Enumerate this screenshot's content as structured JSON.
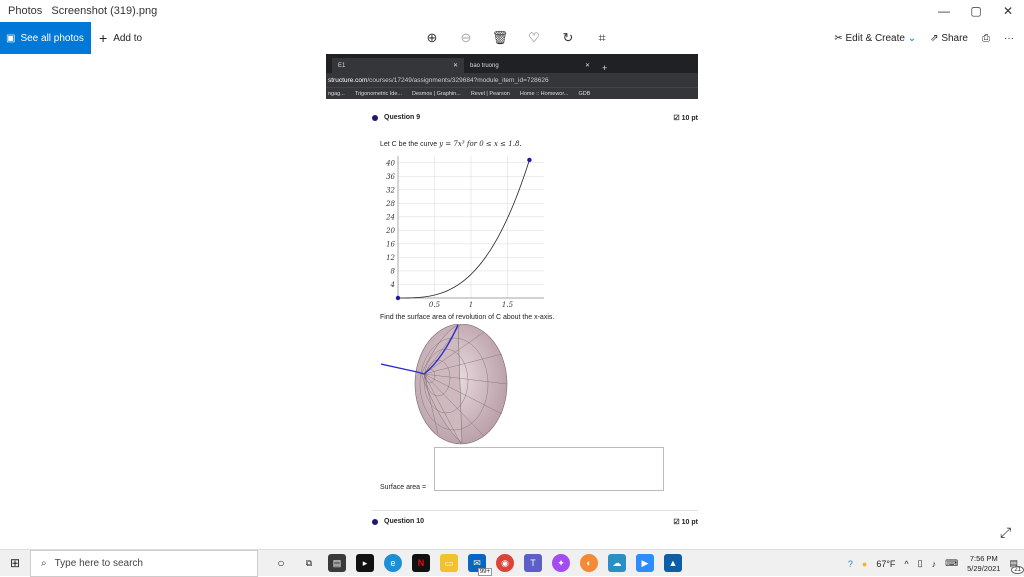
{
  "window": {
    "app": "Photos",
    "filename": "Screenshot (319).png",
    "minimize": "—",
    "maximize": "▢",
    "close": "✕"
  },
  "toolbar": {
    "see_all": "See all photos",
    "add_to": "Add to",
    "edit_create": "Edit & Create",
    "share": "Share"
  },
  "browser": {
    "tabs": [
      {
        "label": "E1"
      },
      {
        "label": "bao truong"
      }
    ],
    "new_tab": "+",
    "url_domain": "structure.com",
    "url_path": "/courses/17249/assignments/329684?module_item_id=728626",
    "bookmarks": [
      "ngag...",
      "Trigonometric Ide...",
      "Desmos | Graphin...",
      "Revel | Pearson",
      "Home :: Homewor...",
      "GDB"
    ]
  },
  "question9": {
    "title": "Question 9",
    "points": "10 pt",
    "prompt_pre": "Let C be the curve ",
    "prompt_math": "y = 7x³ for 0 ≤ x ≤ 1.8.",
    "find": "Find the surface area of revolution of C about the x-axis.",
    "answer_label": "Surface area =",
    "answer_value": ""
  },
  "question10": {
    "title": "Question 10",
    "points": "10 pt"
  },
  "chart_data": {
    "type": "line",
    "x": [
      0,
      0.2,
      0.4,
      0.6,
      0.8,
      1.0,
      1.2,
      1.4,
      1.6,
      1.8
    ],
    "y": [
      0,
      0.056,
      0.448,
      1.512,
      3.584,
      7.0,
      12.096,
      19.208,
      28.672,
      40.824
    ],
    "xticks": [
      "0.5",
      "1",
      "1.5"
    ],
    "yticks": [
      "4",
      "8",
      "12",
      "16",
      "20",
      "24",
      "28",
      "32",
      "36",
      "40"
    ],
    "xlim": [
      0,
      2
    ],
    "ylim": [
      0,
      42
    ],
    "grid": true,
    "endpoints": [
      [
        0,
        0
      ],
      [
        1.8,
        40.824
      ]
    ],
    "curve_color": "#222222",
    "point_color": "#1a1aa8"
  },
  "taskbar": {
    "search_placeholder": "Type here to search",
    "mail_badge": "99+",
    "temperature": "67°F",
    "time": "7:56 PM",
    "date": "5/29/2021",
    "notifications": "21"
  }
}
